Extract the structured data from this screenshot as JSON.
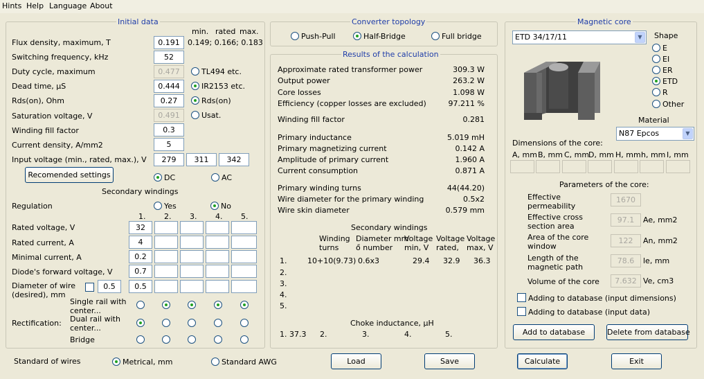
{
  "menu": {
    "hints": "Hints",
    "help": "Help",
    "language": "Language",
    "about": "About"
  },
  "initial": {
    "title": "Initial data",
    "col_min": "min.",
    "col_rated": "rated",
    "col_max": "max.",
    "flux_label": "Flux density, maximum, T",
    "flux_value": "0.191",
    "flux_range": "0.149; 0.166; 0.183",
    "freq_label": "Switching frequency, kHz",
    "freq_value": "52",
    "duty_label": "Duty cycle, maximum",
    "duty_value": "0.477",
    "duty_opt": "TL494 etc.",
    "dead_label": "Dead time, μS",
    "dead_value": "0.444",
    "dead_opt": "IR2153 etc.",
    "rds_label": "Rds(on), Ohm",
    "rds_value": "0.27",
    "rds_opt": "Rds(on)",
    "sat_label": "Saturation voltage, V",
    "sat_value": "0.491",
    "sat_opt": "Usat.",
    "fill_label": "Winding fill factor",
    "fill_value": "0.3",
    "cur_label": "Current density, A/mm2",
    "cur_value": "5",
    "vin_label": "Input voltage (min., rated, max.), V",
    "vin_min": "279",
    "vin_rated": "311",
    "vin_max": "342",
    "rec_button": "Recomended settings",
    "dc": "DC",
    "ac": "AC"
  },
  "secondary": {
    "title": "Secondary windings",
    "regulation": "Regulation",
    "yes": "Yes",
    "no": "No",
    "cols": [
      "1.",
      "2.",
      "3.",
      "4.",
      "5."
    ],
    "rated_v_label": "Rated voltage, V",
    "rated_v": "32",
    "rated_i_label": "Rated current, A",
    "rated_i": "4",
    "min_i_label": "Minimal current, A",
    "min_i": "0.2",
    "diode_label": "Diode's forward voltage, V",
    "diode": "0.7",
    "wire_label1": "Diameter of wire",
    "wire_label2": "(desired), mm",
    "wire_chk_val": "0.5",
    "wire": "0.5",
    "rect_label": "Rectification:",
    "single1": "Single rail with",
    "single2": "center...",
    "dual1": "Dual rail with",
    "dual2": "center...",
    "bridge": "Bridge"
  },
  "bottom": {
    "std_label": "Standard of wires",
    "metric": "Metrical, mm",
    "awg": "Standard AWG",
    "load": "Load",
    "save": "Save",
    "calculate": "Calculate",
    "exit": "Exit"
  },
  "topology": {
    "title": "Converter topology",
    "pp": "Push-Pull",
    "hb": "Half-Bridge",
    "fb": "Full bridge"
  },
  "results": {
    "title": "Results of the calculation",
    "rows": [
      {
        "label": "Approximate rated transformer power",
        "value": "309.3 W"
      },
      {
        "label": "Output power",
        "value": "263.2 W"
      },
      {
        "label": "Core losses",
        "value": "1.098 W"
      },
      {
        "label": "Efficiency (copper losses are excluded)",
        "value": "97.211 %"
      },
      {
        "label": "Winding fill factor",
        "value": "0.281"
      },
      {
        "label": "Primary inductance",
        "value": "5.019 mH"
      },
      {
        "label": "Primary magnetizing current",
        "value": "0.142 A"
      },
      {
        "label": "Amplitude of primary current",
        "value": "1.960 A"
      },
      {
        "label": "Current consumption",
        "value": "0.871 A"
      },
      {
        "label": "Primary winding turns",
        "value": "44(44.20)"
      },
      {
        "label": "Wire diameter for the primary winding",
        "value": "0.5x2"
      },
      {
        "label": "Wire skin diameter",
        "value": "0.579 mm"
      }
    ],
    "sec_title": "Secondary windings",
    "h_turns1": "Winding",
    "h_turns2": "turns",
    "h_diam1": "Diameter mm",
    "h_diam2": "ő number",
    "h_vmin1": "Voltage",
    "h_vmin2": "min, V",
    "h_vrat1": "Voltage",
    "h_vrat2": "rated,",
    "h_vmax1": "Voltage",
    "h_vmax2": "max, V",
    "sec_rows": [
      {
        "n": "1.",
        "turns": "10+10(9.73)",
        "diam": "0.6x3",
        "vmin": "29.4",
        "vrat": "32.9",
        "vmax": "36.3"
      },
      {
        "n": "2."
      },
      {
        "n": "3."
      },
      {
        "n": "4."
      },
      {
        "n": "5."
      }
    ],
    "choke_title": "Choke inductance, μH",
    "choke": [
      "1. 37.3",
      "2.",
      "3.",
      "4.",
      "5."
    ]
  },
  "core": {
    "title": "Magnetic core",
    "selected": "ETD 34/17/11",
    "shape_label": "Shape",
    "shapes": [
      "E",
      "EI",
      "ER",
      "ETD",
      "R",
      "Other"
    ],
    "material_label": "Material",
    "material": "N87 Epcos",
    "dims_label": "Dimensions of the core:",
    "dims_cols": [
      "A, mm",
      "B, mm",
      "C, mm",
      "D, mm",
      "H, mm",
      "h, mm",
      "I, mm"
    ],
    "params_title": "Parameters of the core:",
    "perm1": "Effective",
    "perm2": "permeability",
    "perm_value": "1670",
    "area1": "Effective cross",
    "area2": "section area",
    "area_value": "97.1",
    "area_unit": "Ae, mm2",
    "win1": "Area of the core",
    "win2": "window",
    "win_value": "122",
    "win_unit": "An, mm2",
    "len1": "Length of the",
    "len2": "magnetic path",
    "len_value": "78.6",
    "len_unit": "le, mm",
    "vol_label": "Volume of the core",
    "vol_value": "7.632",
    "vol_unit": "Ve, cm3",
    "db_dims": "Adding to database (input dimensions)",
    "db_data": "Adding to database (input data)",
    "add_db": "Add to database",
    "del_db": "Delete from database"
  }
}
